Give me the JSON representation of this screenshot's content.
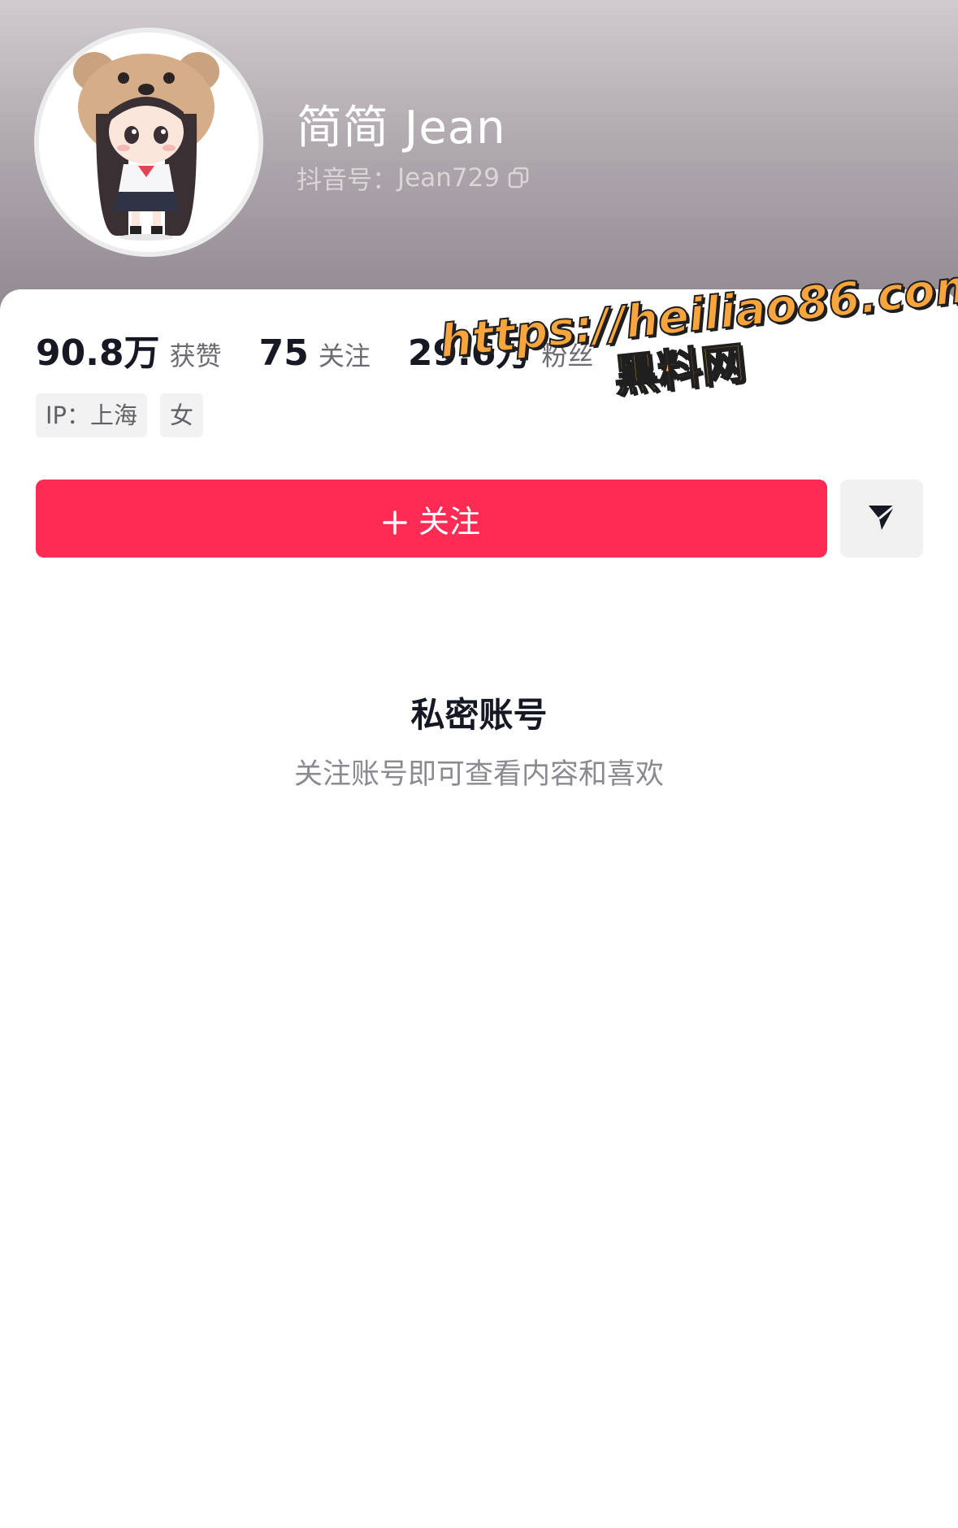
{
  "profile": {
    "name": "简简 Jean",
    "id_label": "抖音号：",
    "id_value": "Jean729"
  },
  "stats": [
    {
      "value": "90.8万",
      "label": "获赞"
    },
    {
      "value": "75",
      "label": "关注"
    },
    {
      "value": "29.6万",
      "label": "粉丝"
    }
  ],
  "tags": [
    "IP：上海",
    "女"
  ],
  "actions": {
    "follow_label": "关注",
    "share_icon": "send-icon"
  },
  "private": {
    "title": "私密账号",
    "subtitle": "关注账号即可查看内容和喜欢"
  },
  "watermark": {
    "url": "https://heiliao86.com",
    "name": "黑料网"
  },
  "colors": {
    "accent": "#fe2c55",
    "watermark": "#f7a53c"
  }
}
